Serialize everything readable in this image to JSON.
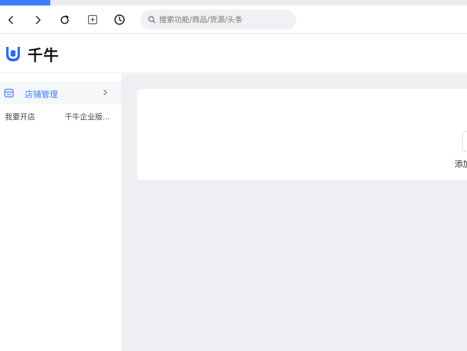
{
  "colors": {
    "accent": "#3d7dff",
    "content_bg": "#eeeff2"
  },
  "toolbar": {
    "back_icon": "chevron-left-icon",
    "forward_icon": "chevron-right-icon",
    "reload_icon": "reload-icon",
    "new_tab_icon": "plus-square-icon",
    "history_icon": "clock-icon",
    "search_placeholder": "搜索功能/商品/货源/头条"
  },
  "brand": {
    "name": "千牛"
  },
  "sidebar": {
    "group": {
      "label": "店铺管理",
      "icon": "store-icon"
    },
    "sub_items": [
      {
        "label": "我要开店"
      },
      {
        "label": "千牛企业版..."
      }
    ]
  },
  "main": {
    "add_module_label": "添加模"
  }
}
